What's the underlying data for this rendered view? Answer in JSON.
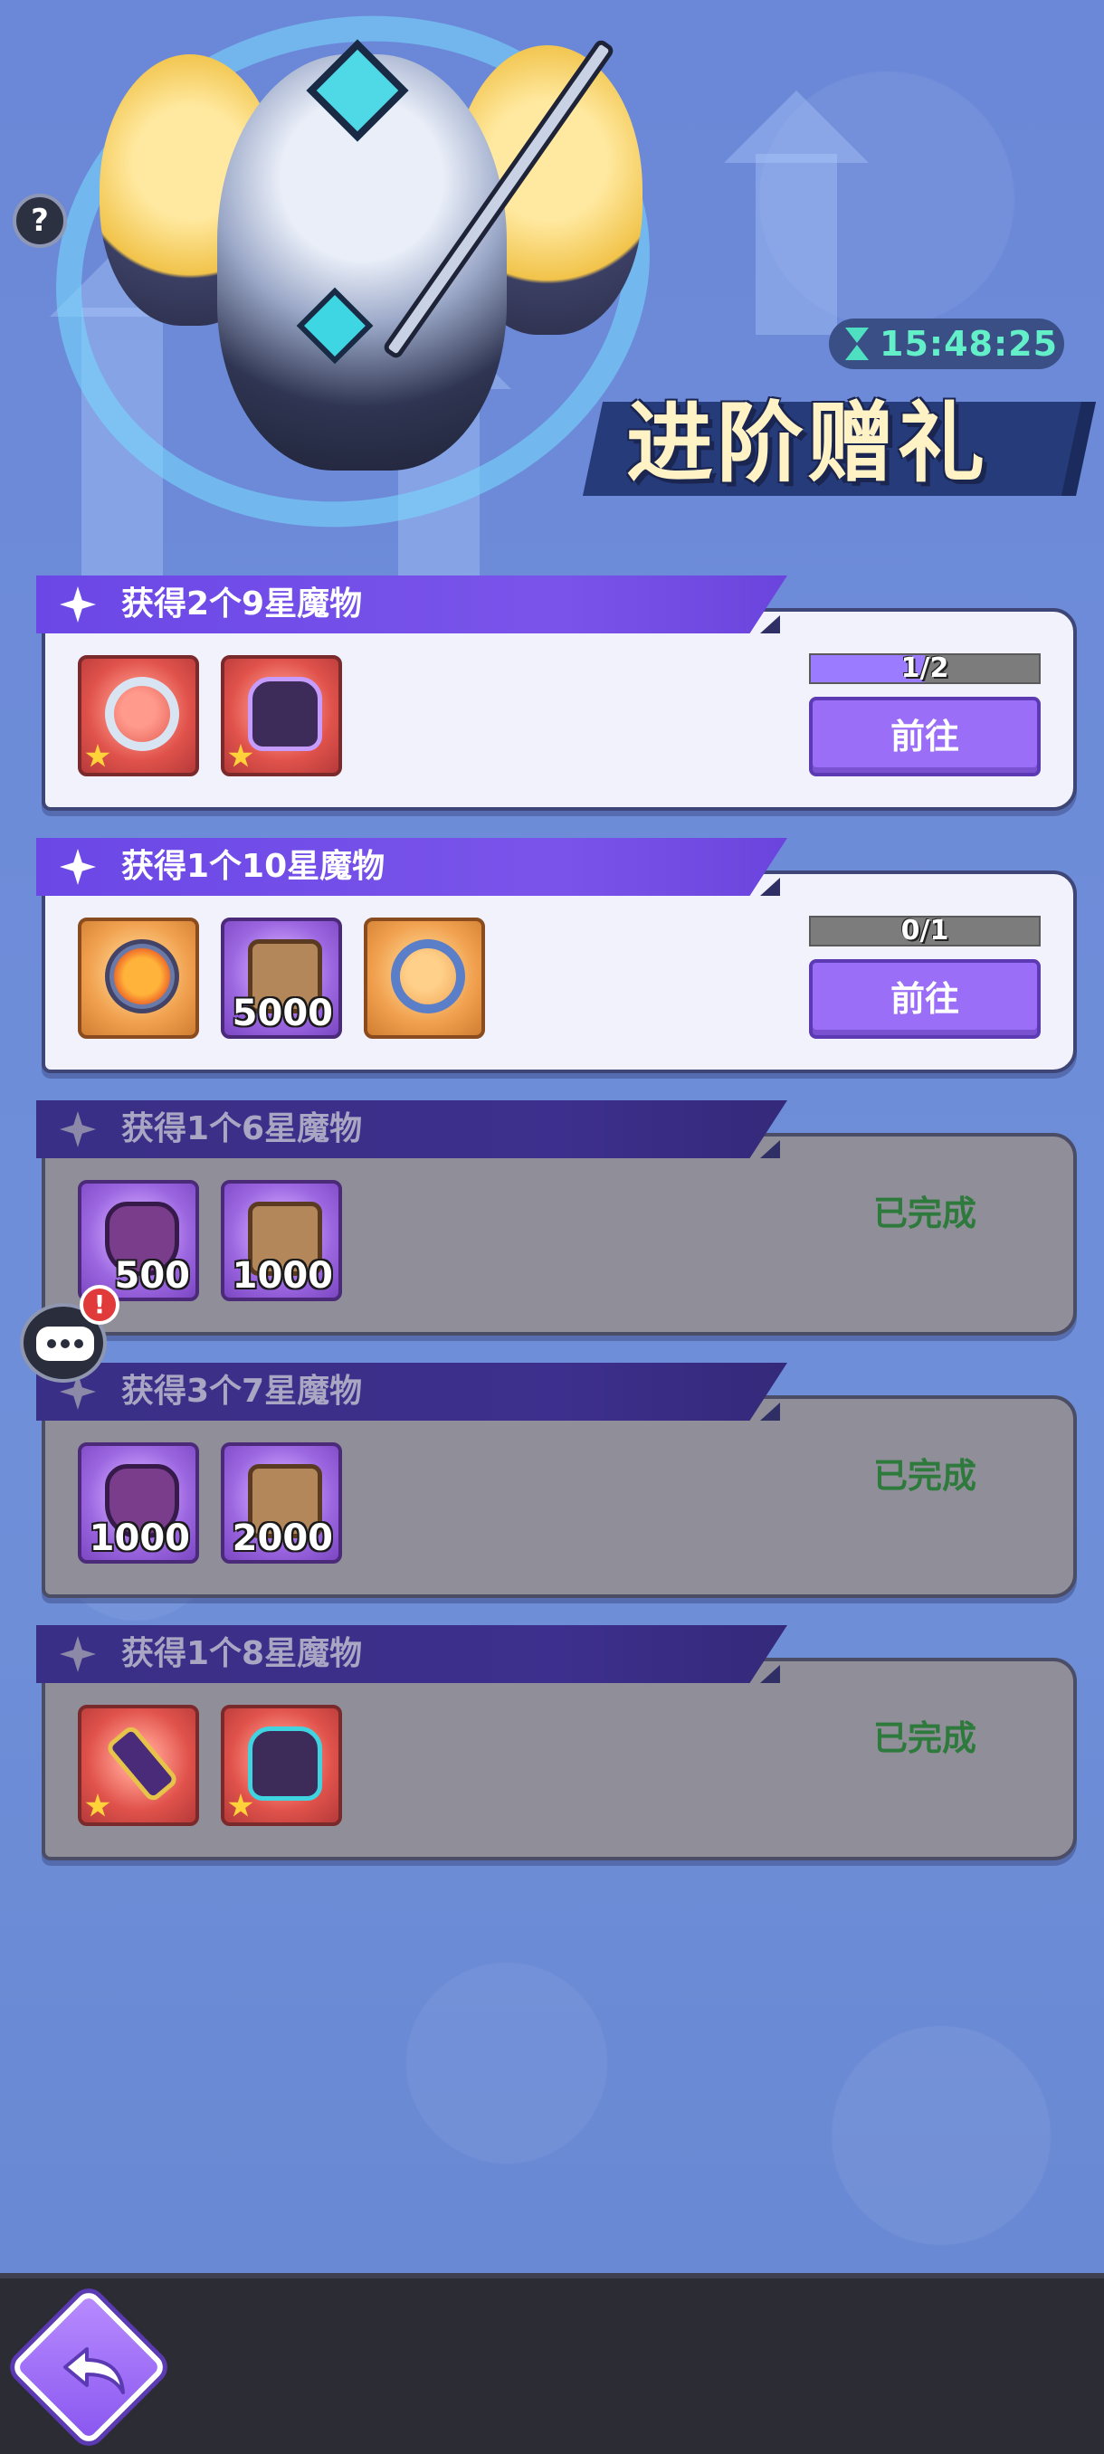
{
  "hero": {
    "help_symbol": "?",
    "timer": "15:48:25",
    "title": "进阶赠礼"
  },
  "tasks": [
    {
      "title": "获得2个9星魔物",
      "status": "in_progress",
      "progress": "1/2",
      "progress_fraction": 0.5,
      "button_label": "前往",
      "rewards": [
        {
          "icon": "ring-icon",
          "count": ""
        },
        {
          "icon": "armor-icon",
          "count": ""
        }
      ]
    },
    {
      "title": "获得1个10星魔物",
      "status": "in_progress",
      "progress": "0/1",
      "progress_fraction": 0,
      "button_label": "前往",
      "rewards": [
        {
          "icon": "emblem-icon",
          "count": ""
        },
        {
          "icon": "scroll-icon",
          "count": "5000"
        },
        {
          "icon": "portal-ring-icon",
          "count": ""
        }
      ]
    },
    {
      "title": "获得1个6星魔物",
      "status": "done",
      "done_label": "已完成",
      "rewards": [
        {
          "icon": "gem-icon",
          "count": "500"
        },
        {
          "icon": "scroll-icon",
          "count": "1000"
        }
      ]
    },
    {
      "title": "获得3个7星魔物",
      "status": "done",
      "done_label": "已完成",
      "rewards": [
        {
          "icon": "gem-icon",
          "count": "1000"
        },
        {
          "icon": "scroll-icon",
          "count": "2000"
        }
      ]
    },
    {
      "title": "获得1个8星魔物",
      "status": "done",
      "done_label": "已完成",
      "rewards": [
        {
          "icon": "sword-icon",
          "count": ""
        },
        {
          "icon": "cloak-icon",
          "count": ""
        }
      ]
    }
  ],
  "chat": {
    "badge": "!"
  },
  "colors": {
    "accent_purple": "#9a6ef6",
    "timer_green": "#63f0c9",
    "done_green": "#2e7a3c"
  }
}
